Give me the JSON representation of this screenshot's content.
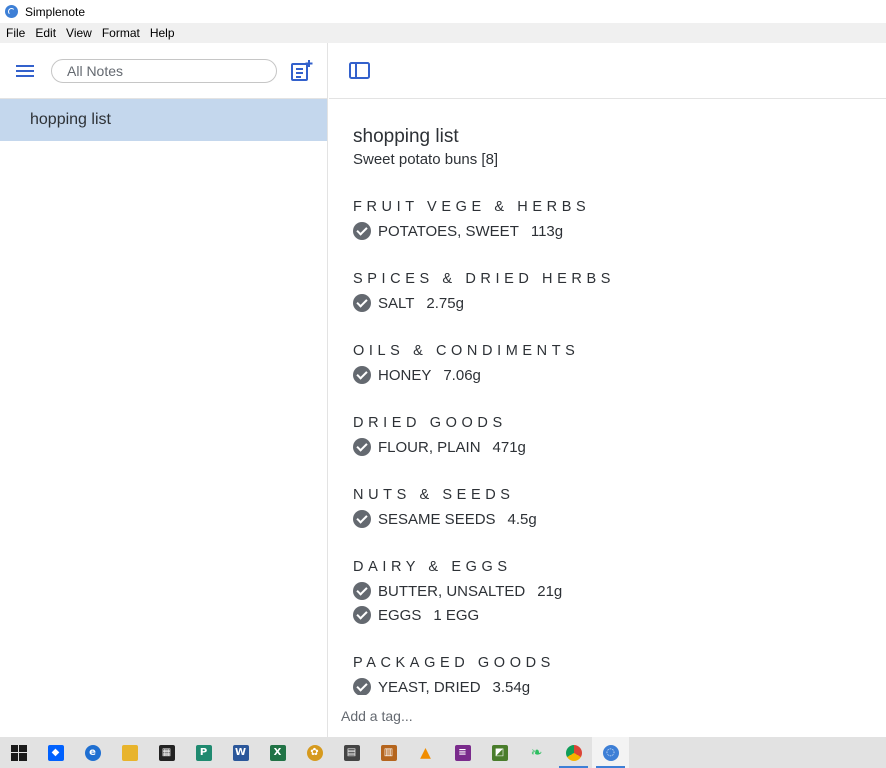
{
  "window": {
    "title": "Simplenote"
  },
  "menubar": {
    "items": [
      "File",
      "Edit",
      "View",
      "Format",
      "Help"
    ]
  },
  "sidebar": {
    "search_placeholder": "All Notes",
    "notes": [
      {
        "title": "hopping list"
      }
    ]
  },
  "note": {
    "title": "shopping list",
    "subtitle": "Sweet potato buns [8]",
    "sections": [
      {
        "heading": "FRUIT VEGE & HERBS",
        "items": [
          {
            "name": "POTATOES, SWEET",
            "qty": "113g"
          }
        ]
      },
      {
        "heading": "SPICES & DRIED HERBS",
        "items": [
          {
            "name": "SALT",
            "qty": "2.75g"
          }
        ]
      },
      {
        "heading": "OILS & CONDIMENTS",
        "items": [
          {
            "name": "HONEY",
            "qty": "7.06g"
          }
        ]
      },
      {
        "heading": "DRIED GOODS",
        "items": [
          {
            "name": "FLOUR, PLAIN",
            "qty": "471g"
          }
        ]
      },
      {
        "heading": "NUTS & SEEDS",
        "items": [
          {
            "name": "SESAME SEEDS",
            "qty": "4.5g"
          }
        ]
      },
      {
        "heading": "DAIRY & EGGS",
        "items": [
          {
            "name": "BUTTER, UNSALTED",
            "qty": "21g"
          },
          {
            "name": "EGGS",
            "qty": "1 EGG"
          }
        ]
      },
      {
        "heading": "PACKAGED GOODS",
        "items": [
          {
            "name": "YEAST, DRIED",
            "qty": "3.54g"
          }
        ]
      }
    ]
  },
  "tag_input": {
    "placeholder": "Add a tag..."
  },
  "colors": {
    "accent": "#3361cc",
    "selected_note": "#c4d7ed",
    "check": "#646970"
  },
  "taskbar": {
    "items": [
      {
        "icon": "windows-start-icon",
        "color": "#1a1a1a",
        "glyph": ""
      },
      {
        "icon": "dropbox-icon",
        "color": "#0061fe",
        "glyph": "◆"
      },
      {
        "icon": "edge-icon",
        "color": "#1f6fd1",
        "glyph": "e"
      },
      {
        "icon": "file-explorer-icon",
        "color": "#e8b42c",
        "glyph": ""
      },
      {
        "icon": "store-icon",
        "color": "#222222",
        "glyph": "▦"
      },
      {
        "icon": "publisher-icon",
        "color": "#1f8a70",
        "glyph": "P"
      },
      {
        "icon": "word-icon",
        "color": "#2b579a",
        "glyph": "W"
      },
      {
        "icon": "excel-icon",
        "color": "#217346",
        "glyph": "X"
      },
      {
        "icon": "app-icon",
        "color": "#d69a1e",
        "glyph": "✿"
      },
      {
        "icon": "calculator-icon",
        "color": "#444444",
        "glyph": "▤"
      },
      {
        "icon": "film-icon",
        "color": "#b5651d",
        "glyph": "▥"
      },
      {
        "icon": "vlc-icon",
        "color": "#f08c00",
        "glyph": "▲"
      },
      {
        "icon": "winrar-icon",
        "color": "#7a2b8c",
        "glyph": "≡"
      },
      {
        "icon": "app-green-icon",
        "color": "#4a7d2c",
        "glyph": "◩"
      },
      {
        "icon": "evernote-icon",
        "color": "#2dbe60",
        "glyph": "❧"
      },
      {
        "icon": "chrome-icon",
        "color": "#db4437",
        "glyph": "●"
      },
      {
        "icon": "simplenote-icon",
        "color": "#3d7fd6",
        "glyph": "◌"
      }
    ]
  }
}
